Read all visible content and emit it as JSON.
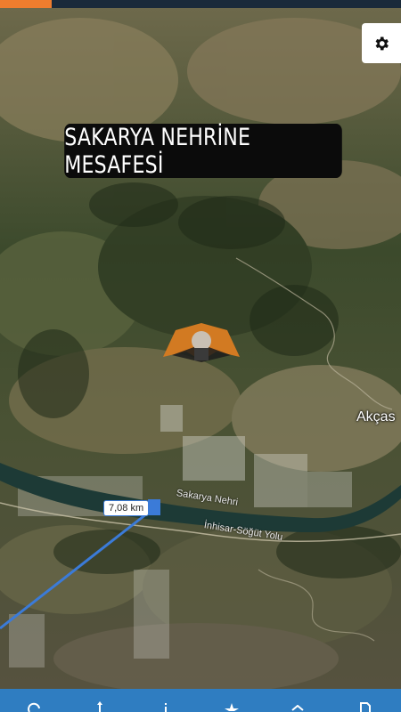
{
  "title": "SAKARYA NEHRİNE MESAFESİ",
  "distance_label": "7,08 km",
  "places": {
    "akcas": "Akças"
  },
  "roads": {
    "river": "Sakarya Nehri",
    "road": "İnhisar-Söğüt Yolu"
  },
  "icons": {
    "settings": "gear-icon",
    "avatar": "user-avatar-marker"
  },
  "bottom_nav": [
    {
      "icon": "refresh-icon"
    },
    {
      "icon": "route-icon"
    },
    {
      "icon": "info-icon"
    },
    {
      "icon": "star-icon"
    },
    {
      "icon": "share-icon"
    },
    {
      "icon": "document-icon"
    }
  ],
  "colors": {
    "measure_line": "#3b7bd8",
    "accent": "#ef7d2e",
    "bottom_bar": "#2f7dc1"
  }
}
